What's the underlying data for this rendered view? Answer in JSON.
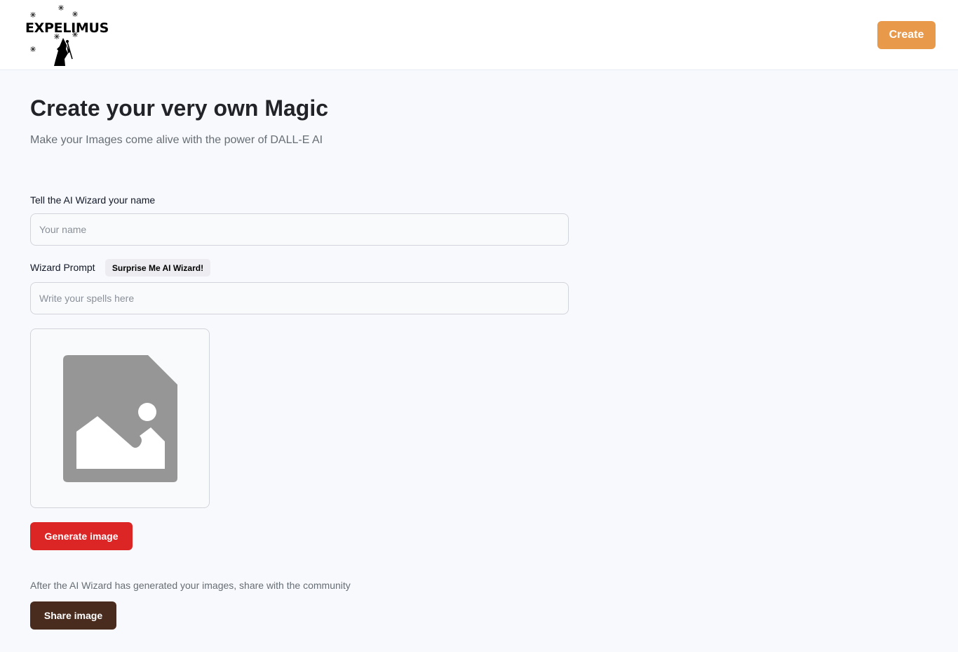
{
  "header": {
    "logo_text": "EXPELIMUS",
    "create_label": "Create",
    "accent_color": "#e8994a"
  },
  "main": {
    "title": "Create your very own Magic",
    "subtitle": "Make your Images come alive with the power of DALL-E AI"
  },
  "form": {
    "name_label": "Tell the AI Wizard your name",
    "name_placeholder": "Your name",
    "prompt_label": "Wizard Prompt",
    "surprise_label": "Surprise Me AI Wizard!",
    "prompt_placeholder": "Write your spells here",
    "preview_icon": "image-placeholder-icon",
    "generate_label": "Generate image",
    "generate_color": "#dc2626"
  },
  "share": {
    "note": "After the AI Wizard has generated your images, share with the community",
    "share_label": "Share image",
    "share_color": "#4a2c1e"
  }
}
